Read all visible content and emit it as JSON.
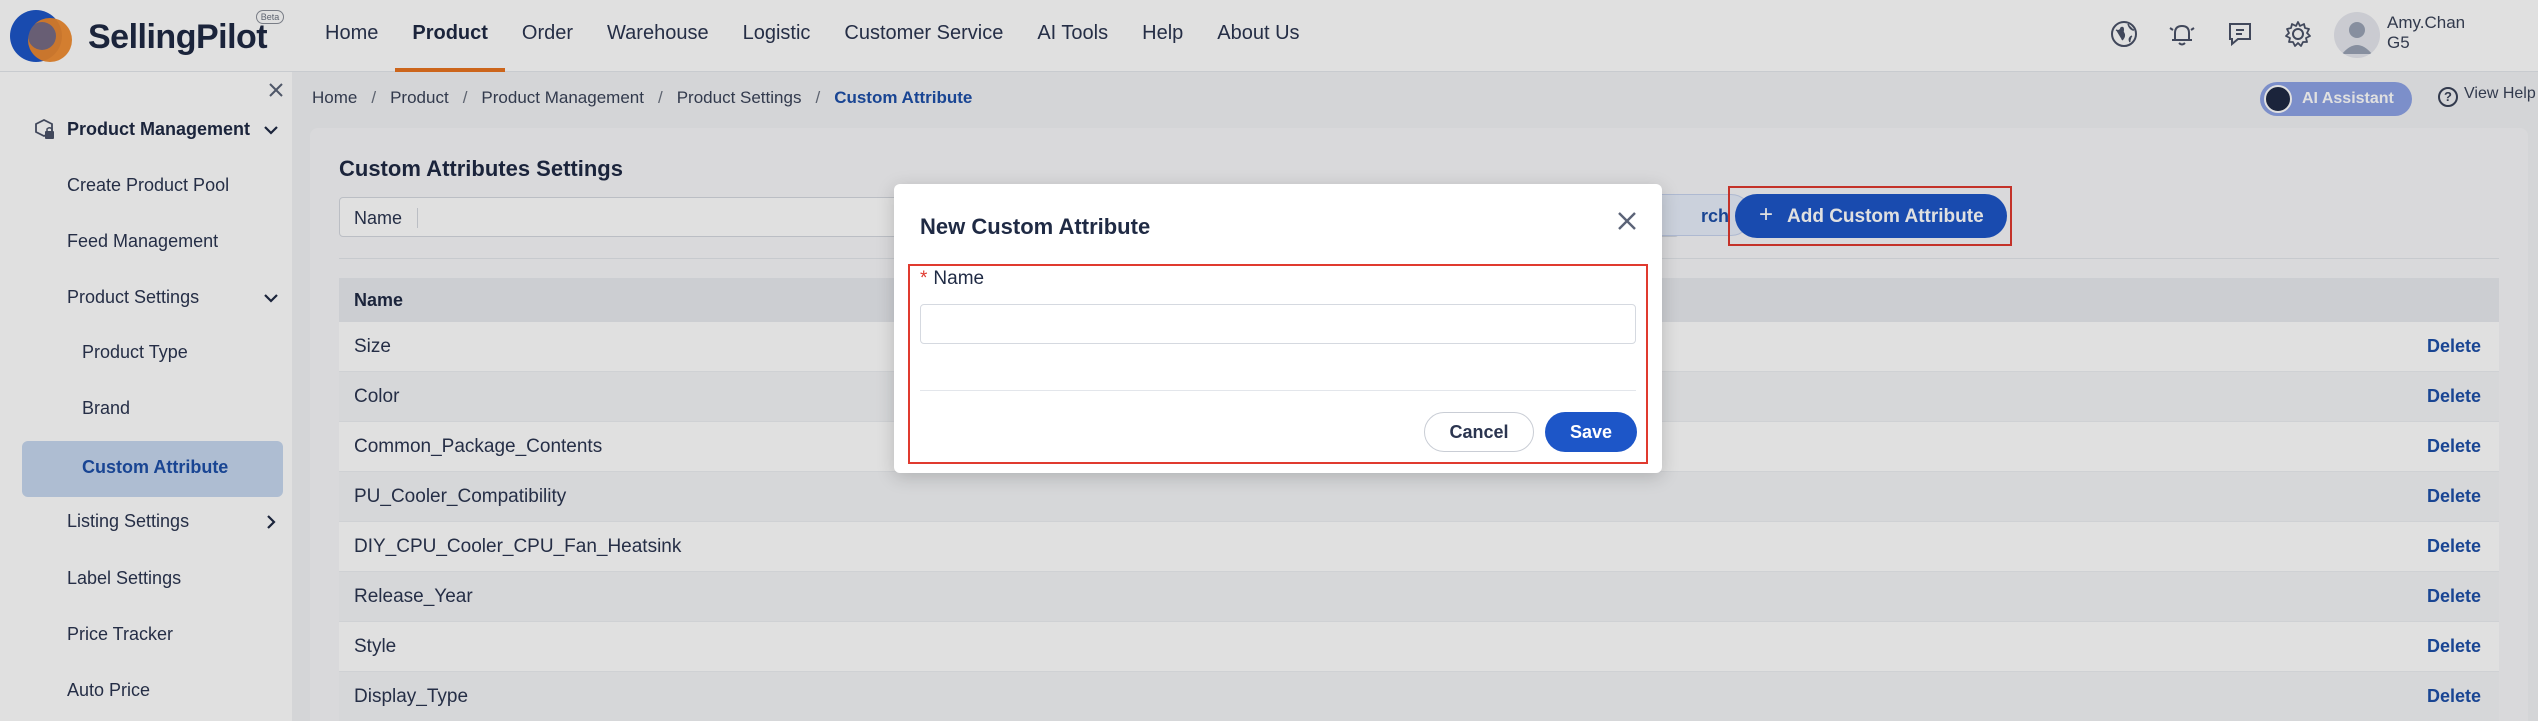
{
  "brand": {
    "name": "SellingPilot",
    "badge": "Beta"
  },
  "nav": {
    "items": [
      "Home",
      "Product",
      "Order",
      "Warehouse",
      "Logistic",
      "Customer Service",
      "AI Tools",
      "Help",
      "About Us"
    ],
    "active": "Product"
  },
  "header_icons": [
    "globe-icon",
    "bell-icon",
    "message-icon",
    "gear-icon"
  ],
  "user": {
    "name": "Amy.Chan",
    "org": "G5"
  },
  "sidebar": {
    "items": [
      {
        "label": "Product Management",
        "icon": "product-lock-icon",
        "expanded": true
      },
      {
        "label": "Create Product Pool"
      },
      {
        "label": "Feed Management"
      },
      {
        "label": "Product Settings",
        "expanded": true
      },
      {
        "label": "Product Type"
      },
      {
        "label": "Brand"
      },
      {
        "label": "Custom Attribute",
        "active": true
      },
      {
        "label": "Listing Settings",
        "collapsed": true
      },
      {
        "label": "Label Settings"
      },
      {
        "label": "Price Tracker"
      },
      {
        "label": "Auto Price"
      }
    ]
  },
  "breadcrumb": [
    "Home",
    "Product",
    "Product Management",
    "Product Settings",
    "Custom Attribute"
  ],
  "ai_assistant_label": "AI Assistant",
  "view_help_label": "View Help",
  "page": {
    "title": "Custom Attributes Settings",
    "filter_label": "Name",
    "search_label": "rch",
    "add_button_label": "Add Custom Attribute"
  },
  "table": {
    "header": "Name",
    "action_label": "Delete",
    "rows": [
      "Size",
      "Color",
      "Common_Package_Contents",
      "PU_Cooler_Compatibility",
      "DIY_CPU_Cooler_CPU_Fan_Heatsink",
      "Release_Year",
      "Style",
      "Display_Type"
    ]
  },
  "modal": {
    "title": "New Custom Attribute",
    "field_required_mark": "*",
    "field_label": "Name",
    "field_value": "",
    "field_placeholder": "",
    "cancel_label": "Cancel",
    "save_label": "Save"
  },
  "colors": {
    "primary": "#1d56c8",
    "accent_orange": "#e9731f",
    "highlight_red": "#e03a2f",
    "sidebar_active_bg": "#c7d8f0"
  }
}
